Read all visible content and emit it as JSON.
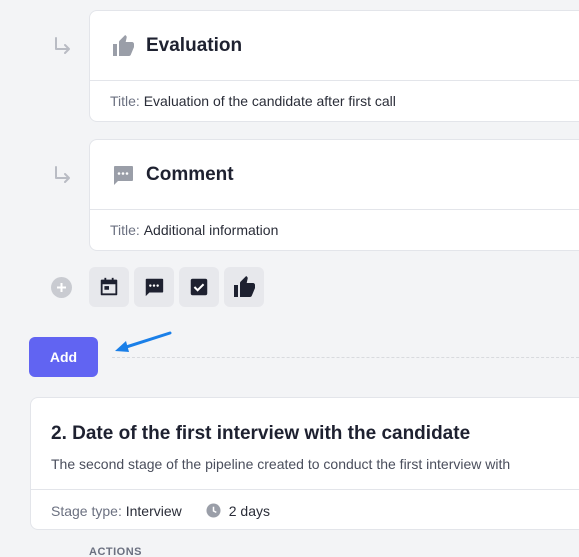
{
  "cards": [
    {
      "title": "Evaluation",
      "icon": "thumb-up-icon",
      "title_key": "Title:",
      "title_value": "Evaluation of the candidate after first call"
    },
    {
      "title": "Comment",
      "icon": "comment-icon",
      "title_key": "Title:",
      "title_value": "Additional information"
    }
  ],
  "toolbar": {
    "tools": [
      "calendar-icon",
      "comment-icon",
      "checkbox-icon",
      "thumb-up-icon"
    ]
  },
  "add_button": {
    "label": "Add"
  },
  "stage": {
    "title": "2. Date of the first interview with the candidate",
    "description": "The second stage of the pipeline created to conduct the first interview with",
    "type_key": "Stage type:",
    "type_value": "Interview",
    "duration": "2 days"
  },
  "actions_label": "ACTIONS",
  "colors": {
    "accent": "#6164f2",
    "pointer": "#1a7fe8",
    "background": "#f3f4f6"
  }
}
